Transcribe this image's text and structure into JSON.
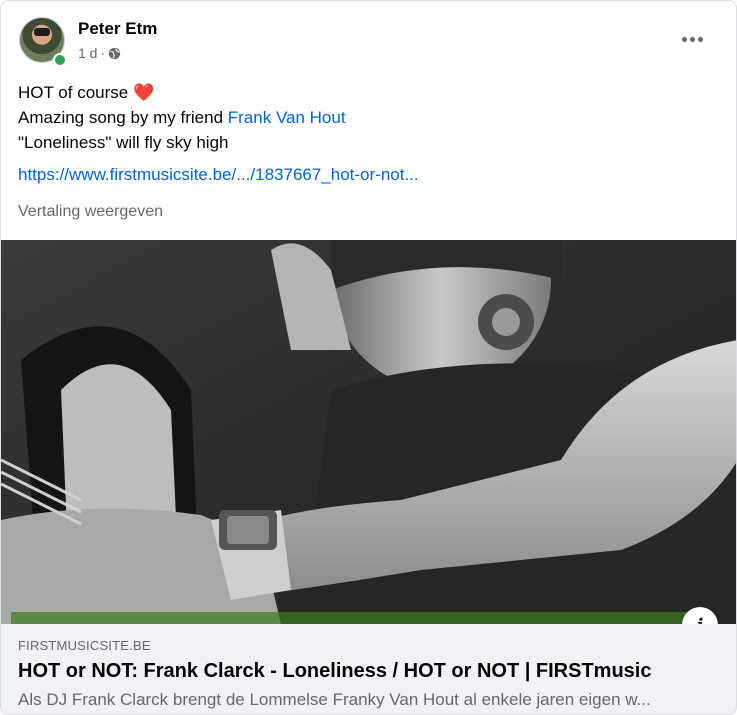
{
  "post": {
    "author": "Peter Etm",
    "time": "1 d",
    "separator": "·",
    "text_line1": "HOT of course",
    "text_line2_prefix": "Amazing song by my friend ",
    "mention": "Frank Van Hout",
    "text_line3": "\"Loneliness\" will fly sky high",
    "link": "https://www.firstmusicsite.be/.../1837667_hot-or-not...",
    "translate_label": "Vertaling weergeven"
  },
  "preview": {
    "domain": "FIRSTMUSICSITE.BE",
    "title": "HOT or NOT: Frank Clarck - Loneliness / HOT or NOT | FIRSTmusic",
    "description": "Als DJ Frank Clarck brengt de Lommelse Franky Van Hout al enkele jaren eigen w..."
  },
  "icons": {
    "heart": "heart-icon",
    "globe": "globe-icon",
    "more": "more-options-icon",
    "info": "info-icon"
  },
  "colors": {
    "link": "#0064d1",
    "online": "#31a24c",
    "heart": "#e41e3f"
  }
}
